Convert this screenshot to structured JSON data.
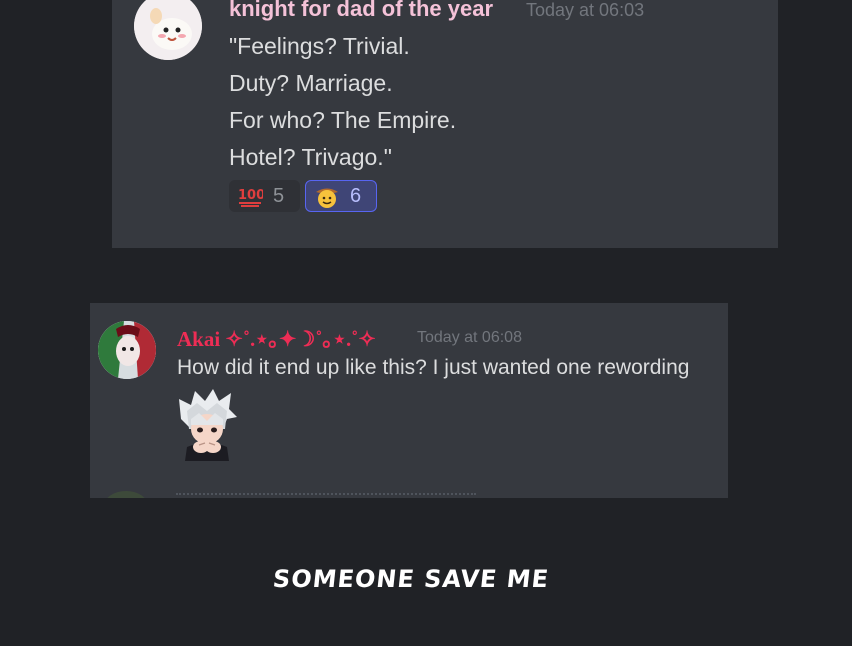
{
  "messages": [
    {
      "username": "knight for dad of the year",
      "timestamp": "Today at 06:03",
      "lines": [
        "\"Feelings? Trivial.",
        "Duty? Marriage.",
        "For who? The Empire.",
        "Hotel? Trivago.\""
      ],
      "reactions": [
        {
          "emoji": "hundred-points-icon",
          "count": "5",
          "active": false
        },
        {
          "emoji": "cowboy-face-icon",
          "count": "6",
          "active": true
        }
      ]
    },
    {
      "username": "Akai ✧˚.⋆｡✦☽˚｡⋆.˚✧",
      "timestamp": "Today at 06:08",
      "text": "How did it end up like this? I just wanted one rewording",
      "attachment": "sticker-image"
    }
  ],
  "caption": "SOMEONE SAVE ME",
  "colors": {
    "background": "#202226",
    "card": "#36393f",
    "knight_name": "#f4c2d8",
    "akai_name": "#ee2d55",
    "timestamp": "#72767d",
    "message_text": "#dcddde",
    "reaction_active_bg": "#3f4576",
    "reaction_active_border": "#5865f2"
  }
}
